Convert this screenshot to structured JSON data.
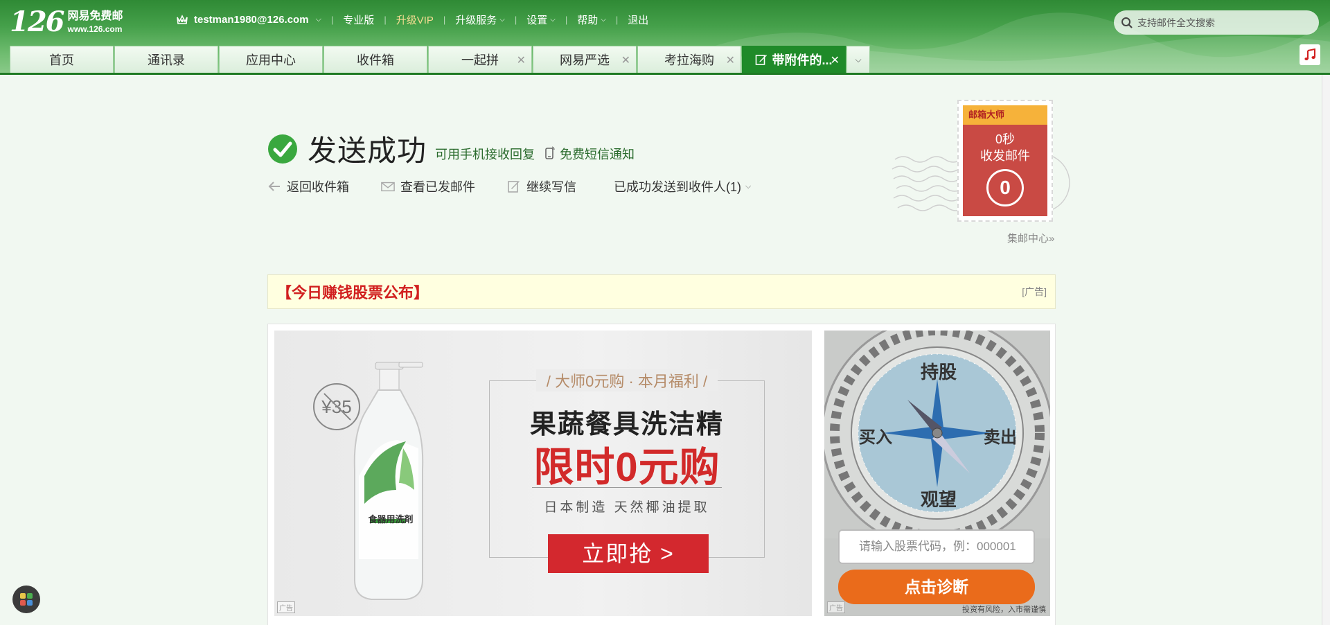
{
  "logo": {
    "number": "126",
    "name": "网易免费邮",
    "domain": "www.126.com"
  },
  "topnav": {
    "account": "testman1980@126.com",
    "items": [
      "专业版",
      "升级VIP",
      "升级服务",
      "设置",
      "帮助",
      "退出"
    ]
  },
  "search": {
    "placeholder": "支持邮件全文搜索"
  },
  "tabs": [
    {
      "label": "首页"
    },
    {
      "label": "通讯录"
    },
    {
      "label": "应用中心"
    },
    {
      "label": "收件箱"
    },
    {
      "label": "一起拼"
    },
    {
      "label": "网易严选"
    },
    {
      "label": "考拉海购"
    },
    {
      "label": "带附件的..."
    }
  ],
  "success": {
    "title": "发送成功",
    "mobile_reply": "可用手机接收回复",
    "sms_notify": "免费短信通知"
  },
  "actions": {
    "back_inbox": "返回收件箱",
    "view_sent": "查看已发邮件",
    "continue_write": "继续写信",
    "sent_to": "已成功发送到收件人(1)"
  },
  "stamp": {
    "brand": "邮箱大师",
    "line1": "0秒",
    "line2": "收发邮件",
    "count": "0",
    "collect_link": "集邮中心»"
  },
  "adbar": {
    "headline": "【今日赚钱股票公布】",
    "tag": "[广告]"
  },
  "ad1": {
    "price": "¥35",
    "sub": "/ 大师0元购 · 本月福利 /",
    "h1": "果蔬餐具洗洁精",
    "h2": "限时0元购",
    "desc": "日本制造  天然椰油提取",
    "button": "立即抢 >",
    "corner": "广告",
    "bottle_label": "食器用洗剤"
  },
  "ad2": {
    "compass": {
      "top": "持股",
      "left": "买入",
      "right": "卖出",
      "bottom": "观望"
    },
    "input_placeholder": "请输入股票代码，例：000001",
    "button": "点击诊断",
    "risk": "投资有风险，入市需谨慎",
    "corner": "广告"
  },
  "colors": {
    "brand_green": "#1f8a29",
    "alert_red": "#d11f1f",
    "cta_orange": "#ea6b1b"
  }
}
